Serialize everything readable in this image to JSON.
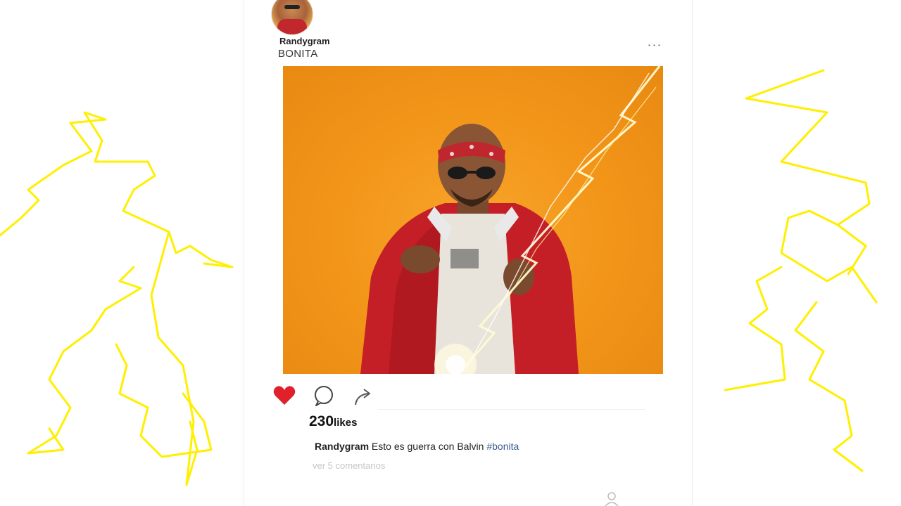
{
  "post": {
    "username": "Randygram",
    "location": "BONITA",
    "menu_icon": "more-options-icon",
    "image_description_icon": "photo",
    "likes_count": "230",
    "likes_label": "likes",
    "caption_user": "Randygram",
    "caption_text": "Esto es guerra con Balvin",
    "caption_hashtag": "#bonita",
    "comments_link": "ver 5 comentarios",
    "liked": true
  },
  "icons": {
    "like": "heart-icon",
    "comment": "comment-icon",
    "share": "share-icon",
    "profile": "profile-icon"
  },
  "colors": {
    "heart": "#e0202a",
    "hashtag": "#3b5b8f",
    "photo_bg": "#f29418",
    "doodle": "#ffef00"
  }
}
